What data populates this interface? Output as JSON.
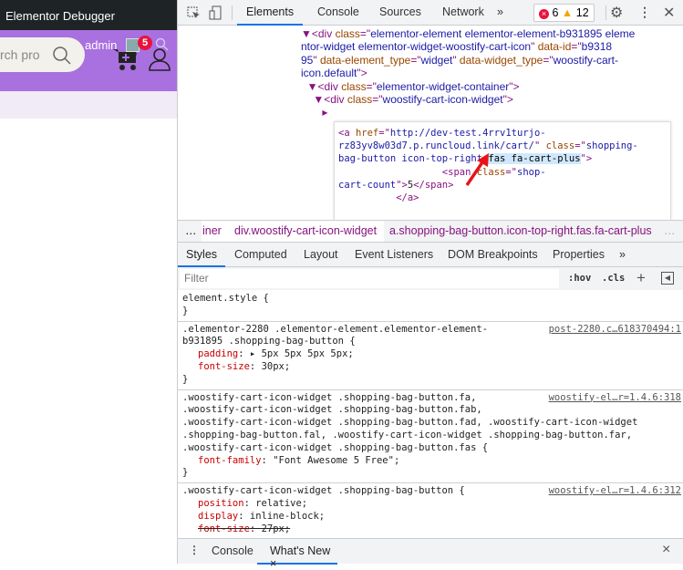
{
  "page": {
    "window_title": "Elementor Debugger",
    "search_placeholder": "rch pro",
    "user": "admin",
    "cart_count": "5",
    "brand_color": "#a970e0"
  },
  "devtools": {
    "tabs": [
      "Elements",
      "Console",
      "Sources",
      "Network",
      "»"
    ],
    "active_tab": "Elements",
    "errors": "6",
    "warnings": "12",
    "elements": [
      [
        [
          "tag",
          "▼<div "
        ],
        [
          "attr",
          "class"
        ],
        [
          "tag",
          "=\""
        ],
        [
          "val",
          "elementor-element elementor-element-b931895 eleme"
        ]
      ],
      [
        [
          "val",
          "ntor-widget elementor-widget-woostify-cart-icon"
        ],
        [
          "tag",
          "\" "
        ],
        [
          "attr",
          "data-id"
        ],
        [
          "tag",
          "=\""
        ],
        [
          "val",
          "b9318"
        ]
      ],
      [
        [
          "val",
          "95"
        ],
        [
          "tag",
          "\" "
        ],
        [
          "attr",
          "data-element_type"
        ],
        [
          "tag",
          "=\""
        ],
        [
          "val",
          "widget"
        ],
        [
          "tag",
          "\" "
        ],
        [
          "attr",
          "data-widget_type"
        ],
        [
          "tag",
          "=\""
        ],
        [
          "val",
          "woostify-cart-"
        ]
      ],
      [
        [
          "val",
          "icon.default"
        ],
        [
          "tag",
          "\">"
        ]
      ],
      [
        [
          "tag",
          "  ▼<div "
        ],
        [
          "attr",
          "class"
        ],
        [
          "tag",
          "=\""
        ],
        [
          "val",
          "elementor-widget-container"
        ],
        [
          "tag",
          "\">"
        ]
      ],
      [
        [
          "tag",
          "    ▼<div "
        ],
        [
          "attr",
          "class"
        ],
        [
          "tag",
          "=\""
        ],
        [
          "val",
          "woostify-cart-icon-widget"
        ],
        [
          "tag",
          "\">"
        ]
      ],
      [
        [
          "tag",
          "       ▸"
        ]
      ]
    ],
    "popup": [
      [
        [
          "tag",
          "<a "
        ],
        [
          "attr",
          "href"
        ],
        [
          "tag",
          "=\""
        ],
        [
          "val",
          "http://dev-test.4rrv1turjo-"
        ]
      ],
      [
        [
          "val",
          "rz83yv8w03d7.p.runcloud.link/cart/"
        ],
        [
          "tag",
          "\" "
        ],
        [
          "attr",
          "class"
        ],
        [
          "tag",
          "=\""
        ],
        [
          "val",
          "shopping-"
        ]
      ],
      [
        [
          "val",
          "bag-button icon-top-right "
        ],
        [
          "hl",
          "fas fa-cart-plus"
        ],
        [
          "tag",
          "\">"
        ]
      ],
      [
        [
          "txt",
          "                  "
        ],
        [
          "tag",
          "<span "
        ],
        [
          "attr",
          "class"
        ],
        [
          "tag",
          "=\""
        ],
        [
          "val",
          "shop-"
        ]
      ],
      [
        [
          "val",
          "cart-count"
        ],
        [
          "tag",
          "\">"
        ],
        [
          "txt",
          "5"
        ],
        [
          "tag",
          "</span>"
        ]
      ],
      [
        [
          "tag",
          "          </a>"
        ]
      ]
    ],
    "breadcrumbs": [
      "…",
      "iner",
      "div.woostify-cart-icon-widget",
      "a.shopping-bag-button.icon-top-right.fas.fa-cart-plus",
      "…"
    ],
    "subtabs": [
      "Styles",
      "Computed",
      "Layout",
      "Event Listeners",
      "DOM Breakpoints",
      "Properties",
      "»"
    ],
    "filter_placeholder": "Filter",
    "hov": ":hov",
    "cls": ".cls",
    "plus": "+",
    "styles": [
      {
        "selector": [
          "element.style {"
        ],
        "source": "",
        "props": []
      },
      {
        "selector": [
          ".elementor-2280 .elementor-element.elementor-element-",
          "b931895 .shopping-bag-button {"
        ],
        "source": "post-2280.c…618370494:1",
        "props": [
          {
            "name": "padding",
            "value": "▸ 5px 5px 5px 5px;"
          },
          {
            "name": "font-size",
            "value": "30px;"
          }
        ]
      },
      {
        "selector": [
          ".woostify-cart-icon-widget .shopping-bag-button.fa,",
          ".woostify-cart-icon-widget .shopping-bag-button.fab,",
          ".woostify-cart-icon-widget .shopping-bag-button.fad, .woostify-cart-icon-widget",
          ".shopping-bag-button.fal, .woostify-cart-icon-widget .shopping-bag-button.far,",
          ".woostify-cart-icon-widget .shopping-bag-button.fas {"
        ],
        "source": "woostify-el…r=1.4.6:318",
        "props": [
          {
            "name": "font-family",
            "value": "\"Font Awesome 5 Free\";"
          }
        ]
      },
      {
        "selector": [
          ".woostify-cart-icon-widget .shopping-bag-button {"
        ],
        "source": "woostify-el…r=1.4.6:312",
        "props": [
          {
            "name": "position",
            "value": "relative;"
          },
          {
            "name": "display",
            "value": "inline-block;"
          },
          {
            "name": "font-size",
            "value": "27px;",
            "struck": true
          }
        ]
      }
    ],
    "drawer_tabs": [
      "Console",
      "What's New"
    ],
    "drawer_close": "×"
  }
}
